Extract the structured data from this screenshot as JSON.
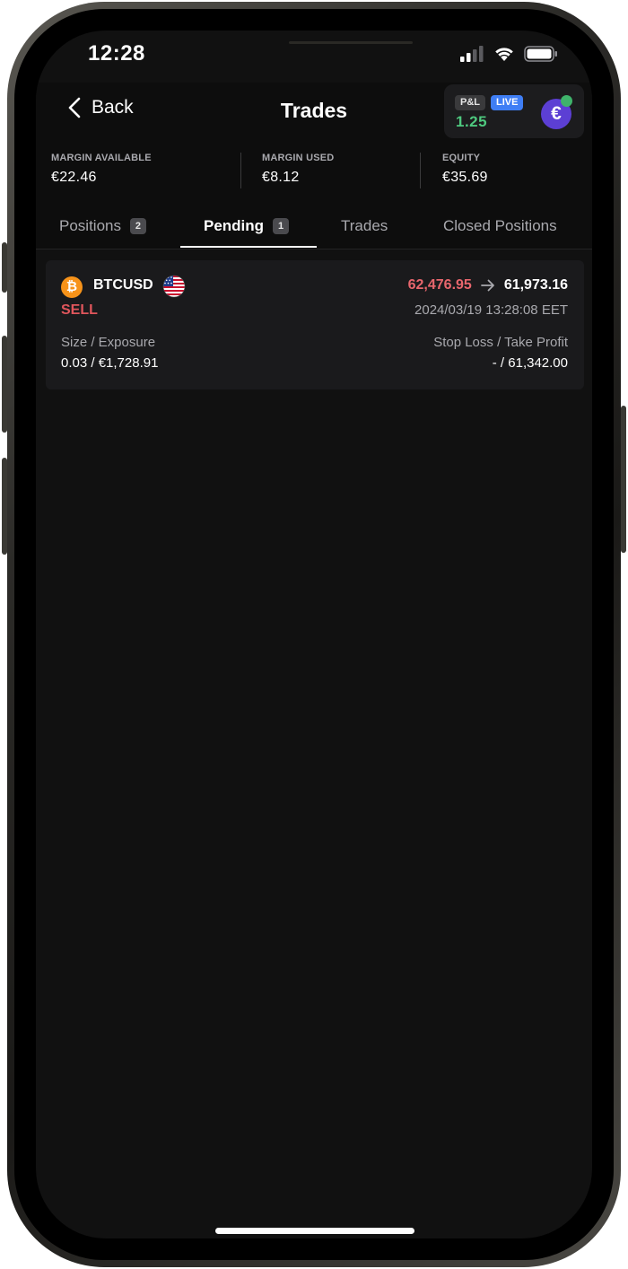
{
  "status_bar": {
    "time": "12:28",
    "icons": [
      "signal-icon",
      "wifi-icon",
      "battery-icon"
    ]
  },
  "header": {
    "back_label": "Back",
    "title": "Trades"
  },
  "pnl": {
    "pnl_badge": "P&L",
    "live_badge": "LIVE",
    "value": "1.25",
    "currency_symbol": "€",
    "value_color": "#4ec97f",
    "live_color": "#3f7ef5"
  },
  "account": {
    "margin_available": {
      "label": "MARGIN AVAILABLE",
      "value": "€22.46"
    },
    "margin_used": {
      "label": "MARGIN USED",
      "value": "€8.12"
    },
    "equity": {
      "label": "EQUITY",
      "value": "€35.69"
    }
  },
  "tabs": [
    {
      "label": "Positions",
      "count": "2"
    },
    {
      "label": "Pending",
      "count": "1",
      "active": true
    },
    {
      "label": "Trades"
    },
    {
      "label": "Closed Positions"
    }
  ],
  "pending_orders": [
    {
      "symbol": "BTCUSD",
      "coin_icon": "bitcoin-icon",
      "flag_icon": "us-flag-icon",
      "side": "SELL",
      "price_from": "62,476.95",
      "price_to": "61,973.16",
      "time": "2024/03/19 13:28:08 EET",
      "size_label": "Size / Exposure",
      "size_value": "0.03 / €1,728.91",
      "sltp_label": "Stop Loss / Take Profit",
      "sltp_value": "- / 61,342.00"
    }
  ],
  "colors": {
    "background": "#111111",
    "sell": "#e0565c",
    "bitcoin": "#f7931a"
  }
}
